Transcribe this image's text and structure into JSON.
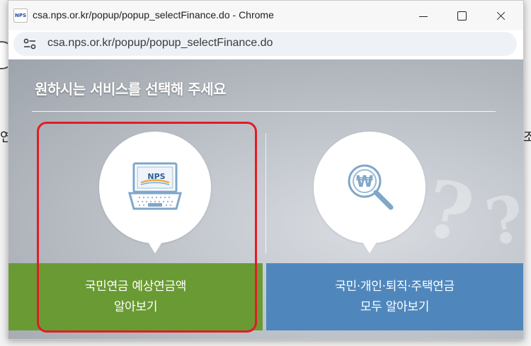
{
  "window": {
    "title": "csa.nps.or.kr/popup/popup_selectFinance.do - Chrome",
    "favicon_text": "NPS",
    "url": "csa.nps.or.kr/popup/popup_selectFinance.do"
  },
  "background": {
    "left_char": "연",
    "right_char": "조"
  },
  "popup": {
    "heading": "원하시는 서비스를 선택해 주세요",
    "options": [
      {
        "line1": "국민연금 예상연금액",
        "line2": "알아보기",
        "icon": "laptop-nps-icon",
        "color": "#6a9a34"
      },
      {
        "line1": "국민·개인·퇴직·주택연금",
        "line2": "모두 알아보기",
        "icon": "magnifier-won-icon",
        "color": "#4f87bd"
      }
    ],
    "laptop_screen_text": "NPS",
    "magnifier_symbol": "₩"
  },
  "highlight_color": "#e21c24"
}
